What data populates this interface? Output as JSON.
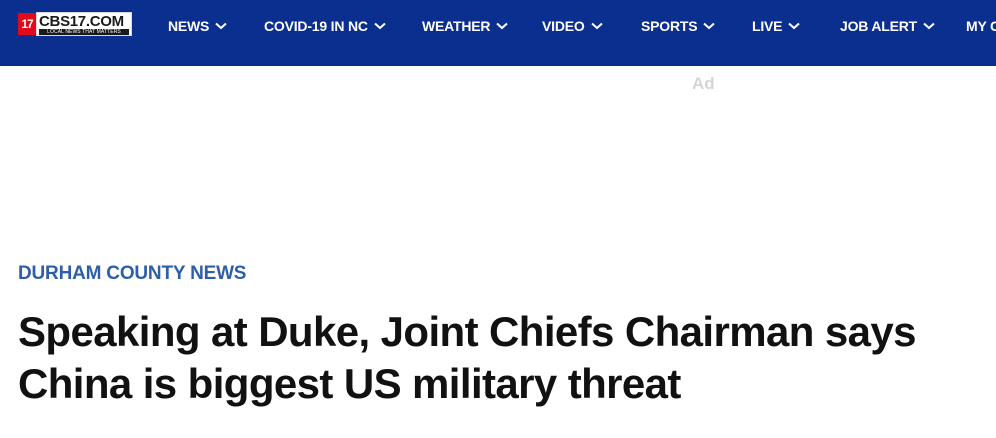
{
  "site": {
    "logo_mark": "17",
    "logo_text": "CBS17.COM",
    "logo_tagline": "LOCAL NEWS THAT MATTERS"
  },
  "nav": {
    "items": [
      {
        "label": "NEWS",
        "has_dropdown": true
      },
      {
        "label": "COVID-19 IN NC",
        "has_dropdown": true
      },
      {
        "label": "WEATHER",
        "has_dropdown": true
      },
      {
        "label": "VIDEO",
        "has_dropdown": true
      },
      {
        "label": "SPORTS",
        "has_dropdown": true
      },
      {
        "label": "LIVE",
        "has_dropdown": true
      },
      {
        "label": "JOB ALERT",
        "has_dropdown": true
      },
      {
        "label": "MY C",
        "has_dropdown": false
      }
    ]
  },
  "ad": {
    "label": "Ad"
  },
  "article": {
    "category": "DURHAM COUNTY NEWS",
    "headline": "Speaking at Duke, Joint Chiefs Chairman says China is biggest US military threat"
  },
  "colors": {
    "nav_background": "#0a2f8f",
    "category_text": "#2d5fa8",
    "headline_text": "#111111",
    "logo_red": "#e10a1a"
  },
  "icons": {
    "dropdown": "chevron-down-icon"
  }
}
